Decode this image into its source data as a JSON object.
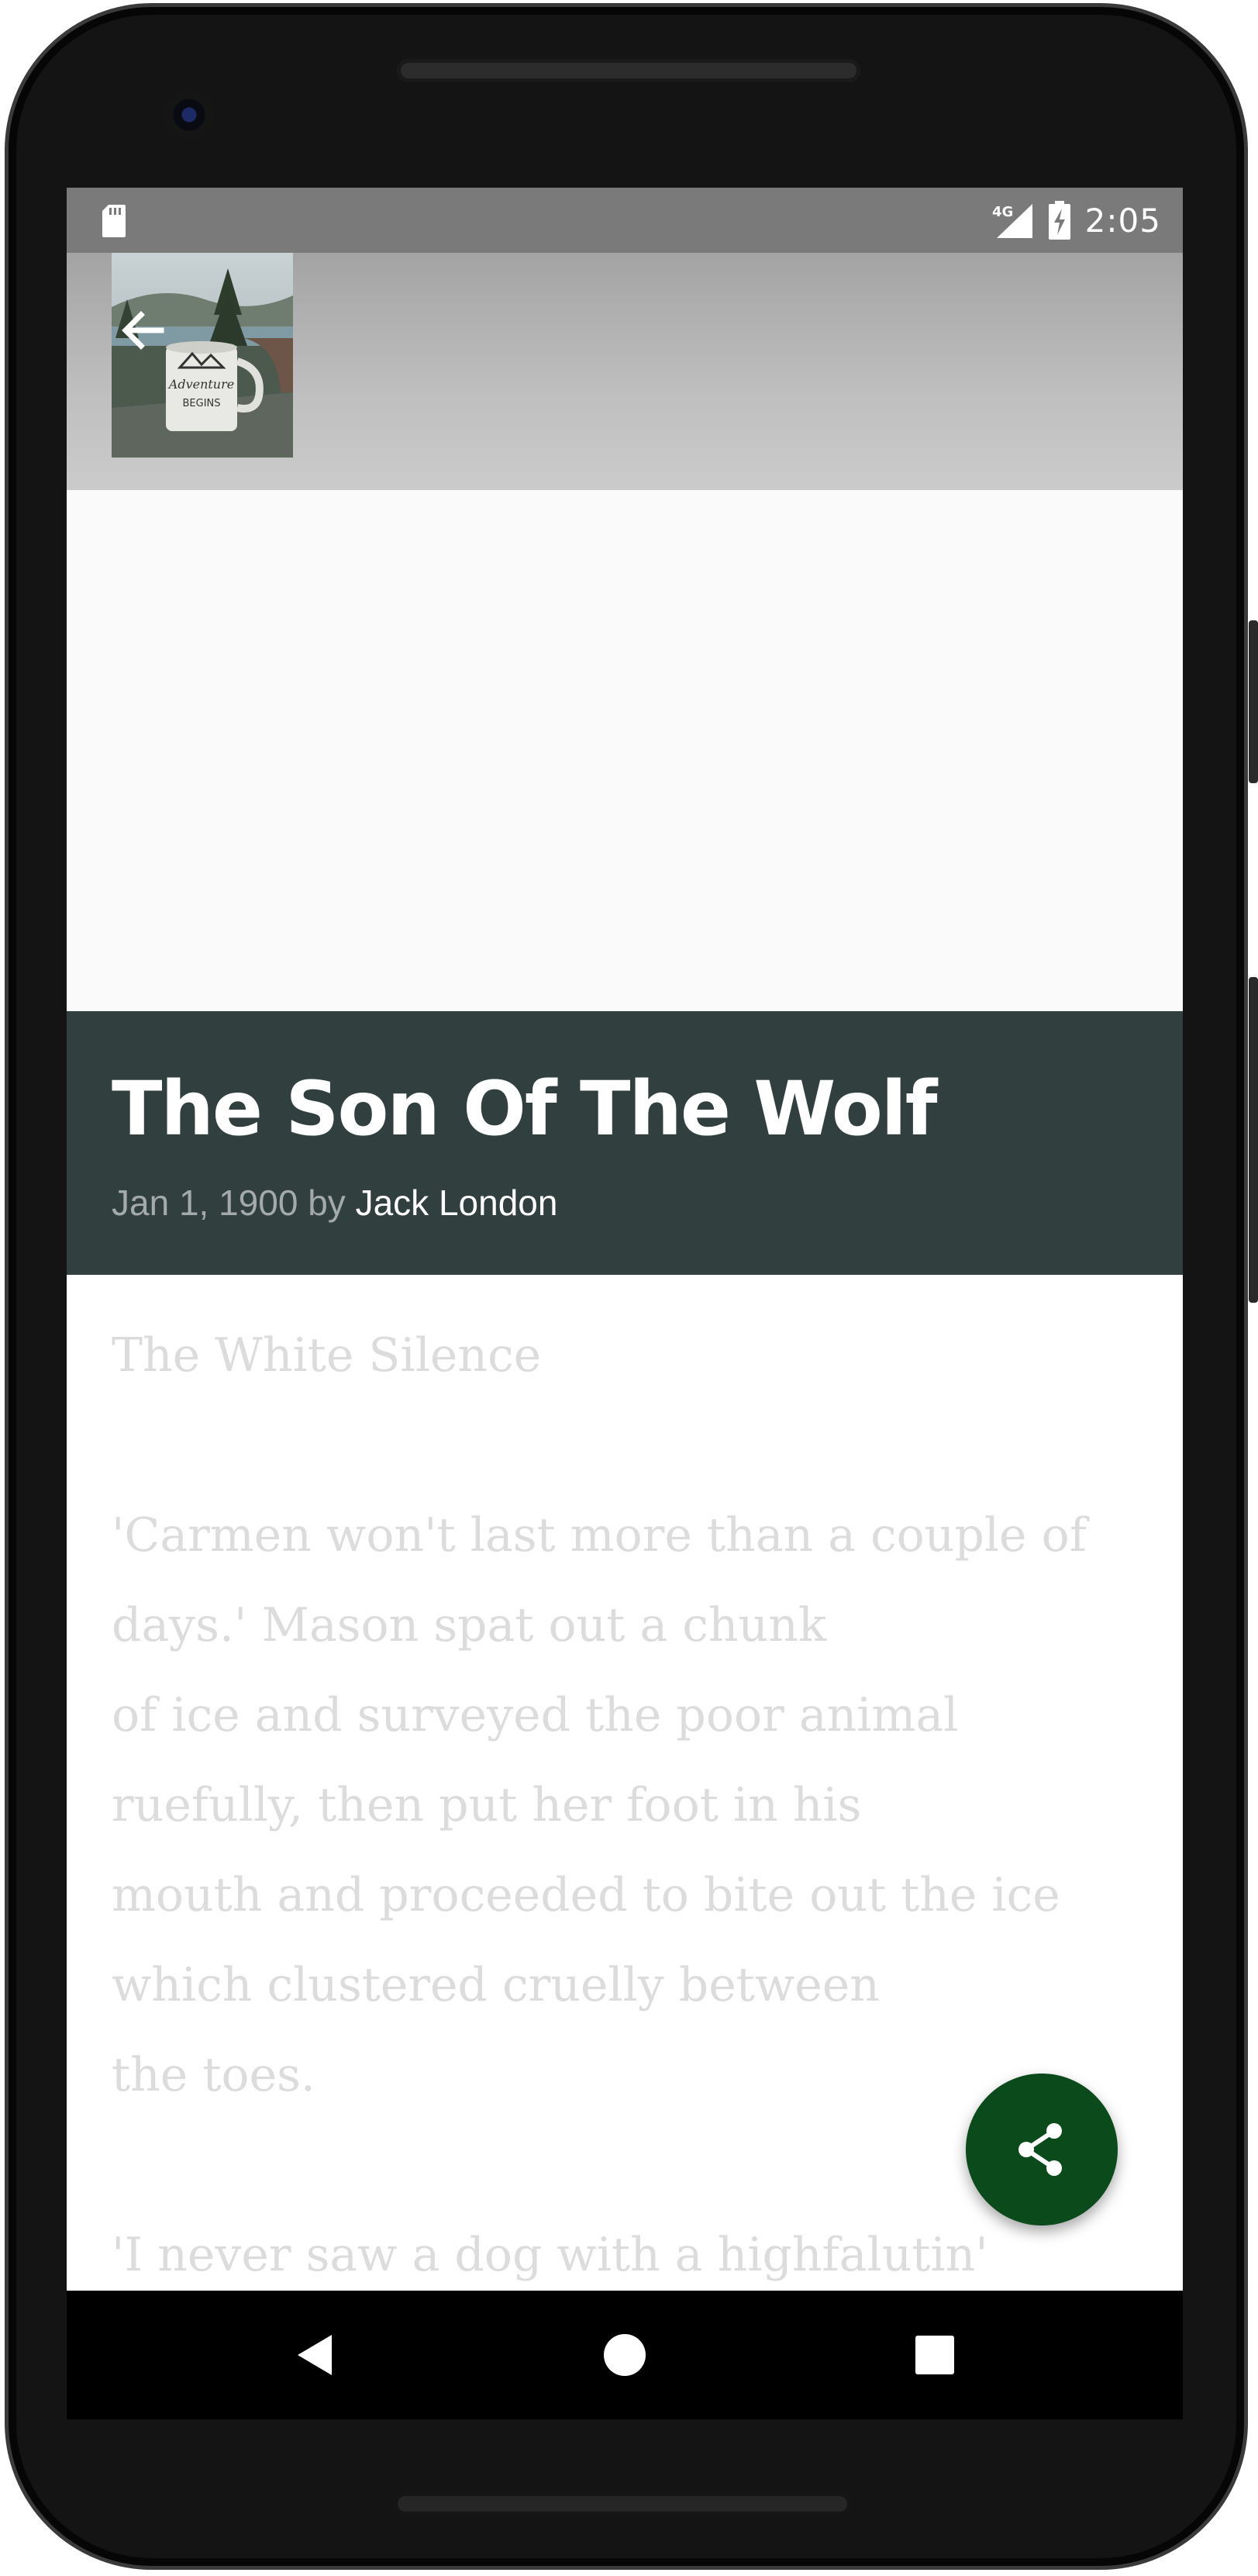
{
  "status_bar": {
    "time": "2:05",
    "network": "4G"
  },
  "app_bar": {
    "cover_text": "Adventure BEGINS"
  },
  "story": {
    "title": "The Son Of The Wolf",
    "date": "Jan 1, 1900",
    "by": "by",
    "author": "Jack London",
    "chapter_title": "The White Silence",
    "paragraphs": [
      [
        "'Carmen won't last more than a couple of",
        "days.' Mason spat out a chunk",
        "of ice and surveyed the poor animal",
        "ruefully, then put her foot in his",
        "mouth and proceeded to bite out the ice",
        "which clustered cruelly between",
        "the toes."
      ],
      [
        "'I never saw a dog with a highfalutin'"
      ]
    ]
  },
  "colors": {
    "title_band": "#323f3f",
    "fab": "#0b4a1b",
    "status_bar": "#7a7a7a",
    "body_text": "#dcdcdc"
  },
  "icons": {
    "back": "arrow-back-icon",
    "share": "share-icon",
    "nav_back": "triangle-back-icon",
    "nav_home": "circle-home-icon",
    "nav_recents": "square-recents-icon"
  }
}
